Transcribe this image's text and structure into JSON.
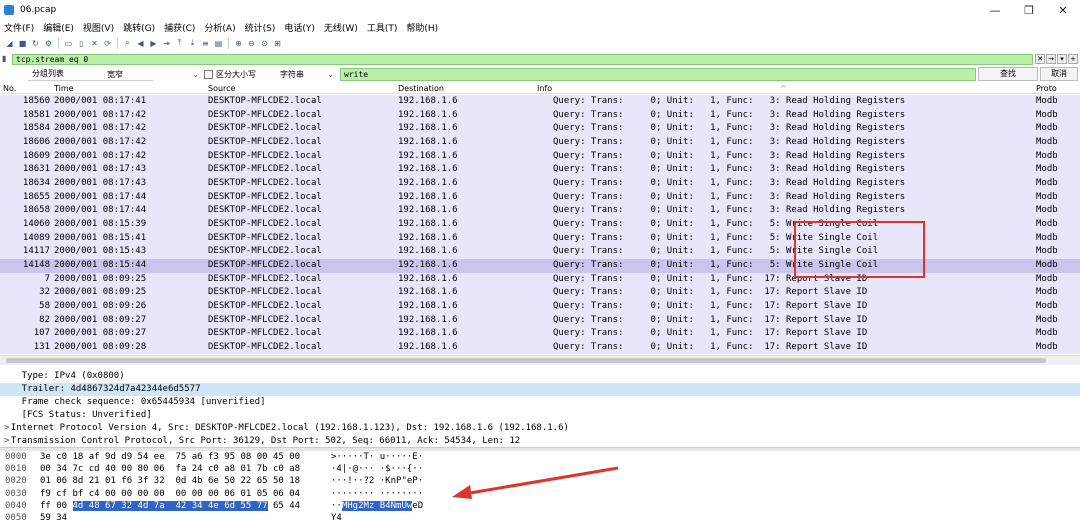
{
  "window": {
    "title": "06.pcap",
    "controls": [
      "—",
      "❐",
      "✕"
    ]
  },
  "menu": [
    "文件(F)",
    "编辑(E)",
    "视图(V)",
    "跳转(G)",
    "捕获(C)",
    "分析(A)",
    "统计(S)",
    "电话(Y)",
    "无线(W)",
    "工具(T)",
    "帮助(H)"
  ],
  "toolbar_icons": [
    "shark-fin-start-icon",
    "stop-icon",
    "restart-icon",
    "options-icon",
    "open-folder-icon",
    "file-icon",
    "close-file-icon",
    "reload-icon",
    "find-icon",
    "back-icon",
    "forward-icon",
    "goto-icon",
    "first-icon",
    "last-icon",
    "autoscroll-icon",
    "colorize-icon",
    "zoom-in-icon",
    "zoom-out-icon",
    "zoom-reset-icon",
    "resize-columns-icon"
  ],
  "display_filter": {
    "value": "tcp.stream eq 0"
  },
  "search": {
    "scope": "分组列表",
    "charset": "宽窄",
    "case_label": "区分大小写",
    "type": "字符串",
    "value": "write",
    "find_label": "查找",
    "cancel_label": "取消"
  },
  "columns": {
    "no": "No.",
    "time": "Time",
    "source": "Source",
    "destination": "Destination",
    "info": "Info",
    "protocol": "Proto"
  },
  "packets": [
    {
      "no": "18560",
      "time": "2000/001 08:17:41",
      "src": "DESKTOP-MFLCDE2.local",
      "dst": "192.168.1.6",
      "info": "Query: Trans:     0; Unit:   1, Func:   3: Read Holding Registers",
      "proto": "Modb"
    },
    {
      "no": "18581",
      "time": "2000/001 08:17:42",
      "src": "DESKTOP-MFLCDE2.local",
      "dst": "192.168.1.6",
      "info": "Query: Trans:     0; Unit:   1, Func:   3: Read Holding Registers",
      "proto": "Modb"
    },
    {
      "no": "18584",
      "time": "2000/001 08:17:42",
      "src": "DESKTOP-MFLCDE2.local",
      "dst": "192.168.1.6",
      "info": "Query: Trans:     0; Unit:   1, Func:   3: Read Holding Registers",
      "proto": "Modb"
    },
    {
      "no": "18606",
      "time": "2000/001 08:17:42",
      "src": "DESKTOP-MFLCDE2.local",
      "dst": "192.168.1.6",
      "info": "Query: Trans:     0; Unit:   1, Func:   3: Read Holding Registers",
      "proto": "Modb"
    },
    {
      "no": "18609",
      "time": "2000/001 08:17:42",
      "src": "DESKTOP-MFLCDE2.local",
      "dst": "192.168.1.6",
      "info": "Query: Trans:     0; Unit:   1, Func:   3: Read Holding Registers",
      "proto": "Modb"
    },
    {
      "no": "18631",
      "time": "2000/001 08:17:43",
      "src": "DESKTOP-MFLCDE2.local",
      "dst": "192.168.1.6",
      "info": "Query: Trans:     0; Unit:   1, Func:   3: Read Holding Registers",
      "proto": "Modb"
    },
    {
      "no": "18634",
      "time": "2000/001 08:17:43",
      "src": "DESKTOP-MFLCDE2.local",
      "dst": "192.168.1.6",
      "info": "Query: Trans:     0; Unit:   1, Func:   3: Read Holding Registers",
      "proto": "Modb"
    },
    {
      "no": "18655",
      "time": "2000/001 08:17:44",
      "src": "DESKTOP-MFLCDE2.local",
      "dst": "192.168.1.6",
      "info": "Query: Trans:     0; Unit:   1, Func:   3: Read Holding Registers",
      "proto": "Modb"
    },
    {
      "no": "18658",
      "time": "2000/001 08:17:44",
      "src": "DESKTOP-MFLCDE2.local",
      "dst": "192.168.1.6",
      "info": "Query: Trans:     0; Unit:   1, Func:   3: Read Holding Registers",
      "proto": "Modb"
    },
    {
      "no": "14060",
      "time": "2000/001 08:15:39",
      "src": "DESKTOP-MFLCDE2.local",
      "dst": "192.168.1.6",
      "info": "Query: Trans:     0; Unit:   1, Func:   5: Write Single Coil",
      "proto": "Modb"
    },
    {
      "no": "14089",
      "time": "2000/001 08:15:41",
      "src": "DESKTOP-MFLCDE2.local",
      "dst": "192.168.1.6",
      "info": "Query: Trans:     0; Unit:   1, Func:   5: Write Single Coil",
      "proto": "Modb"
    },
    {
      "no": "14117",
      "time": "2000/001 08:15:43",
      "src": "DESKTOP-MFLCDE2.local",
      "dst": "192.168.1.6",
      "info": "Query: Trans:     0; Unit:   1, Func:   5: Write Single Coil",
      "proto": "Modb"
    },
    {
      "no": "14148",
      "time": "2000/001 08:15:44",
      "src": "DESKTOP-MFLCDE2.local",
      "dst": "192.168.1.6",
      "info": "Query: Trans:     0; Unit:   1, Func:   5: Write Single Coil",
      "proto": "Modb",
      "selected": true
    },
    {
      "no": "7",
      "time": "2000/001 08:09:25",
      "src": "DESKTOP-MFLCDE2.local",
      "dst": "192.168.1.6",
      "info": "Query: Trans:     0; Unit:   1, Func:  17: Report Slave ID",
      "proto": "Modb"
    },
    {
      "no": "32",
      "time": "2000/001 08:09:25",
      "src": "DESKTOP-MFLCDE2.local",
      "dst": "192.168.1.6",
      "info": "Query: Trans:     0; Unit:   1, Func:  17: Report Slave ID",
      "proto": "Modb"
    },
    {
      "no": "58",
      "time": "2000/001 08:09:26",
      "src": "DESKTOP-MFLCDE2.local",
      "dst": "192.168.1.6",
      "info": "Query: Trans:     0; Unit:   1, Func:  17: Report Slave ID",
      "proto": "Modb"
    },
    {
      "no": "82",
      "time": "2000/001 08:09:27",
      "src": "DESKTOP-MFLCDE2.local",
      "dst": "192.168.1.6",
      "info": "Query: Trans:     0; Unit:   1, Func:  17: Report Slave ID",
      "proto": "Modb"
    },
    {
      "no": "107",
      "time": "2000/001 08:09:27",
      "src": "DESKTOP-MFLCDE2.local",
      "dst": "192.168.1.6",
      "info": "Query: Trans:     0; Unit:   1, Func:  17: Report Slave ID",
      "proto": "Modb"
    },
    {
      "no": "131",
      "time": "2000/001 08:09:28",
      "src": "DESKTOP-MFLCDE2.local",
      "dst": "192.168.1.6",
      "info": "Query: Trans:     0; Unit:   1, Func:  17: Report Slave ID",
      "proto": "Modb"
    }
  ],
  "details": [
    {
      "text": "    Type: IPv4 (0x0800)"
    },
    {
      "text": "    Trailer: 4d4867324d7a42344e6d5577",
      "selected": true
    },
    {
      "text": "    Frame check sequence: 0x65445934 [unverified]"
    },
    {
      "text": "    [FCS Status: Unverified]"
    },
    {
      "text": "  Internet Protocol Version 4, Src: DESKTOP-MFLCDE2.local (192.168.1.123), Dst: 192.168.1.6 (192.168.1.6)",
      "caret": ">"
    },
    {
      "text": "  Transmission Control Protocol, Src Port: 36129, Dst Port: 502, Seq: 66011, Ack: 54534, Len: 12",
      "caret": ">"
    }
  ],
  "bytes": [
    {
      "off": "0000",
      "hex": "3e c0 18 af 9d d9 54 ee  75 a6 f3 95 08 00 45 00",
      "asc": ">·····T· u·····E·"
    },
    {
      "off": "0010",
      "hex": "00 34 7c cd 40 00 80 06  fa 24 c0 a8 01 7b c0 a8",
      "asc": "·4|·@··· ·$···{··"
    },
    {
      "off": "0020",
      "hex": "01 06 8d 21 01 f6 3f 32  0d 4b 6e 50 22 65 50 18",
      "asc": "···!··?2 ·KnP\"eP·"
    },
    {
      "off": "0030",
      "hex": "f9 cf bf c4 00 00 00 00  00 00 00 06 01 05 06 04",
      "asc": "········ ········"
    },
    {
      "off": "0040",
      "hex_pre": "ff 00 ",
      "hex_hl": "4d 48 67 32 4d 7a  42 34 4e 6d 55 77",
      "hex_post": " 65 44",
      "asc_pre": "··",
      "asc_hl": "MHg2Mz B4NmUw",
      "asc_post": "eD"
    },
    {
      "off": "0050",
      "hex": "59 34",
      "asc": "Y4"
    }
  ],
  "annotation": {
    "box_color": "#e0332e",
    "arrow_color": "#e0332e"
  }
}
